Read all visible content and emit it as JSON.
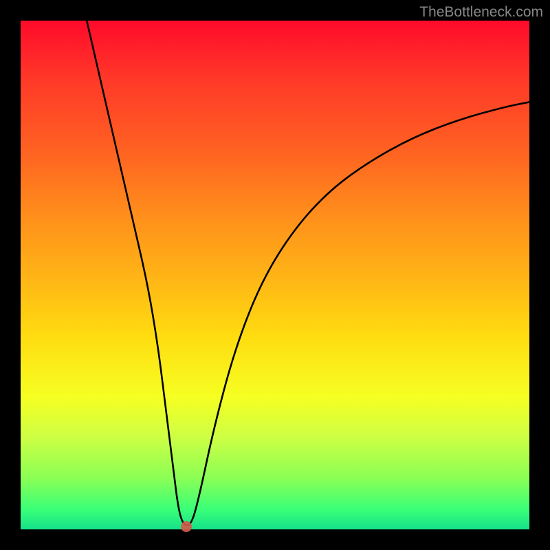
{
  "watermark": "TheBottleneck.com",
  "chart_data": {
    "type": "line",
    "title": "",
    "xlabel": "",
    "ylabel": "",
    "xlim": [
      0,
      100
    ],
    "ylim": [
      0,
      100
    ],
    "series": [
      {
        "name": "curve",
        "x": [
          13,
          16,
          19,
          22,
          25,
          27,
          28.5,
          30,
          31,
          32,
          33.5,
          35,
          38,
          42,
          47,
          53,
          60,
          68,
          77,
          86,
          95,
          100
        ],
        "y": [
          100,
          87,
          74,
          61,
          48,
          36,
          24,
          12,
          4,
          0.8,
          0.8,
          6,
          20,
          35,
          48,
          58,
          66,
          72,
          77,
          80.5,
          83,
          84
        ]
      }
    ],
    "marker": {
      "x": 32.5,
      "y": 0.5
    },
    "gradient_stops": [
      {
        "pos": 0,
        "color": "#ff0a2a"
      },
      {
        "pos": 25,
        "color": "#ff6022"
      },
      {
        "pos": 50,
        "color": "#ffb316"
      },
      {
        "pos": 74,
        "color": "#f6ff22"
      },
      {
        "pos": 100,
        "color": "#16e28a"
      }
    ]
  }
}
